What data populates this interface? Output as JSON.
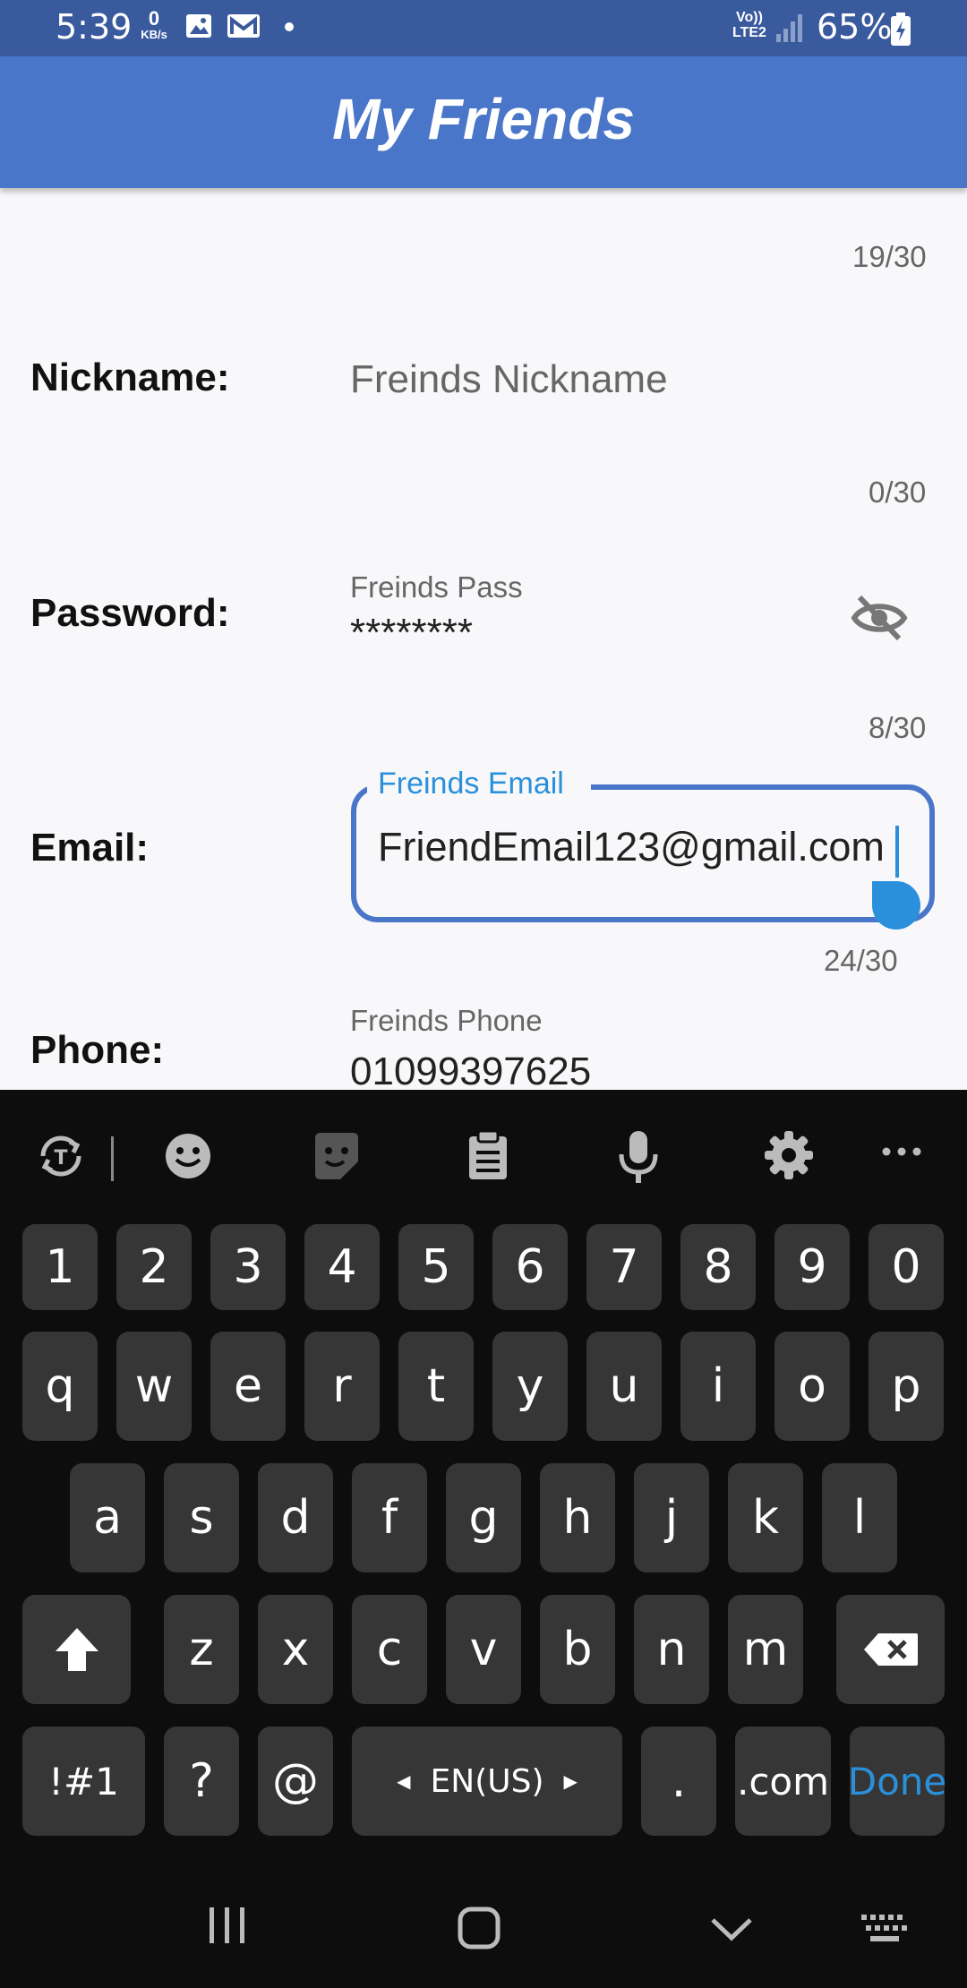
{
  "status_bar": {
    "time": "5:39",
    "net_speed_value": "0",
    "net_speed_unit": "KB/s",
    "volte_top": "Vo))",
    "volte_bottom": "LTE2",
    "battery": "65%"
  },
  "app_bar": {
    "title": "My Friends"
  },
  "form": {
    "top_counter": "19/30",
    "nickname": {
      "label": "Nickname:",
      "placeholder": "Freinds Nickname",
      "counter": "0/30"
    },
    "password": {
      "label": "Password:",
      "floating_label": "Freinds Pass",
      "value": "********",
      "counter": "8/30"
    },
    "email": {
      "label": "Email:",
      "floating_label": "Freinds Email",
      "value": "FriendEmail123@gmail.com",
      "counter": "24/30"
    },
    "phone": {
      "label": "Phone:",
      "floating_label": "Freinds Phone",
      "value": "01099397625"
    }
  },
  "keyboard": {
    "number_row": [
      "1",
      "2",
      "3",
      "4",
      "5",
      "6",
      "7",
      "8",
      "9",
      "0"
    ],
    "row1": [
      "q",
      "w",
      "e",
      "r",
      "t",
      "y",
      "u",
      "i",
      "o",
      "p"
    ],
    "row2": [
      "a",
      "s",
      "d",
      "f",
      "g",
      "h",
      "j",
      "k",
      "l"
    ],
    "row3": [
      "z",
      "x",
      "c",
      "v",
      "b",
      "n",
      "m"
    ],
    "symbols_key": "!#1",
    "question_key": "?",
    "at_key": "@",
    "language": "EN(US)",
    "period_key": ".",
    "dotcom_key": ".com",
    "done_key": "Done"
  },
  "colors": {
    "status_bar": "#3a5a9e",
    "app_bar": "#4a76c9",
    "accent": "#2a90db",
    "keyboard_bg": "#0d0d0d",
    "key_bg": "#363636"
  }
}
